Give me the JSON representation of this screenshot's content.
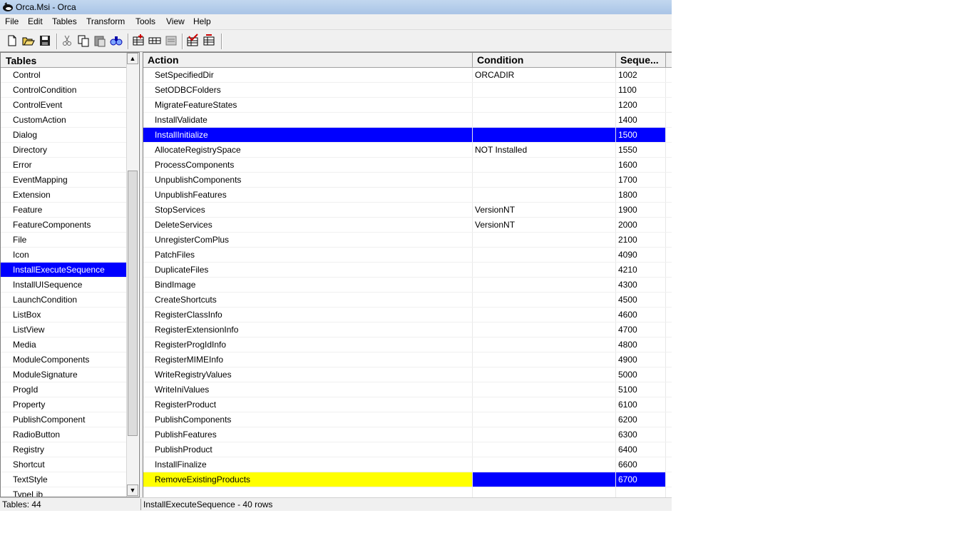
{
  "window": {
    "title": "Orca.Msi - Orca"
  },
  "menu": [
    "File",
    "Edit",
    "Tables",
    "Transform",
    "Tools",
    "View",
    "Help"
  ],
  "toolbar": {
    "icons": [
      "new-file-icon",
      "open-folder-icon",
      "save-icon",
      "cut-icon",
      "copy-icon",
      "paste-icon",
      "find-icon",
      "add-table-icon",
      "add-row-icon",
      "properties-icon",
      "validate-icon",
      "drop-table-icon"
    ]
  },
  "tables_pane": {
    "header": "Tables",
    "items": [
      "Control",
      "ControlCondition",
      "ControlEvent",
      "CustomAction",
      "Dialog",
      "Directory",
      "Error",
      "EventMapping",
      "Extension",
      "Feature",
      "FeatureComponents",
      "File",
      "Icon",
      "InstallExecuteSequence",
      "InstallUISequence",
      "LaunchCondition",
      "ListBox",
      "ListView",
      "Media",
      "ModuleComponents",
      "ModuleSignature",
      "ProgId",
      "Property",
      "PublishComponent",
      "RadioButton",
      "Registry",
      "Shortcut",
      "TextStyle",
      "TypeLib"
    ],
    "selected": "InstallExecuteSequence"
  },
  "grid": {
    "columns": [
      "Action",
      "Condition",
      "Seque..."
    ],
    "rows": [
      {
        "action": "SetSpecifiedDir",
        "condition": "ORCADIR",
        "sequence": "1002"
      },
      {
        "action": "SetODBCFolders",
        "condition": "",
        "sequence": "1100"
      },
      {
        "action": "MigrateFeatureStates",
        "condition": "",
        "sequence": "1200"
      },
      {
        "action": "InstallValidate",
        "condition": "",
        "sequence": "1400"
      },
      {
        "action": "InstallInitialize",
        "condition": "",
        "sequence": "1500",
        "state": "selected"
      },
      {
        "action": "AllocateRegistrySpace",
        "condition": "NOT Installed",
        "sequence": "1550"
      },
      {
        "action": "ProcessComponents",
        "condition": "",
        "sequence": "1600"
      },
      {
        "action": "UnpublishComponents",
        "condition": "",
        "sequence": "1700"
      },
      {
        "action": "UnpublishFeatures",
        "condition": "",
        "sequence": "1800"
      },
      {
        "action": "StopServices",
        "condition": "VersionNT",
        "sequence": "1900"
      },
      {
        "action": "DeleteServices",
        "condition": "VersionNT",
        "sequence": "2000"
      },
      {
        "action": "UnregisterComPlus",
        "condition": "",
        "sequence": "2100"
      },
      {
        "action": "PatchFiles",
        "condition": "",
        "sequence": "4090"
      },
      {
        "action": "DuplicateFiles",
        "condition": "",
        "sequence": "4210"
      },
      {
        "action": "BindImage",
        "condition": "",
        "sequence": "4300"
      },
      {
        "action": "CreateShortcuts",
        "condition": "",
        "sequence": "4500"
      },
      {
        "action": "RegisterClassInfo",
        "condition": "",
        "sequence": "4600"
      },
      {
        "action": "RegisterExtensionInfo",
        "condition": "",
        "sequence": "4700"
      },
      {
        "action": "RegisterProgIdInfo",
        "condition": "",
        "sequence": "4800"
      },
      {
        "action": "RegisterMIMEInfo",
        "condition": "",
        "sequence": "4900"
      },
      {
        "action": "WriteRegistryValues",
        "condition": "",
        "sequence": "5000"
      },
      {
        "action": "WriteIniValues",
        "condition": "",
        "sequence": "5100"
      },
      {
        "action": "RegisterProduct",
        "condition": "",
        "sequence": "6100"
      },
      {
        "action": "PublishComponents",
        "condition": "",
        "sequence": "6200"
      },
      {
        "action": "PublishFeatures",
        "condition": "",
        "sequence": "6300"
      },
      {
        "action": "PublishProduct",
        "condition": "",
        "sequence": "6400"
      },
      {
        "action": "InstallFinalize",
        "condition": "",
        "sequence": "6600"
      },
      {
        "action": "RemoveExistingProducts",
        "condition": "",
        "sequence": "6700",
        "state": "highlighted"
      },
      {
        "action": "",
        "condition": "",
        "sequence": ""
      }
    ]
  },
  "status": {
    "tables_count": "Tables: 44",
    "table_info": "InstallExecuteSequence - 40 rows"
  },
  "colors": {
    "selection": "#0000ff",
    "highlight": "#ffff00",
    "chrome": "#f0f0f0"
  }
}
